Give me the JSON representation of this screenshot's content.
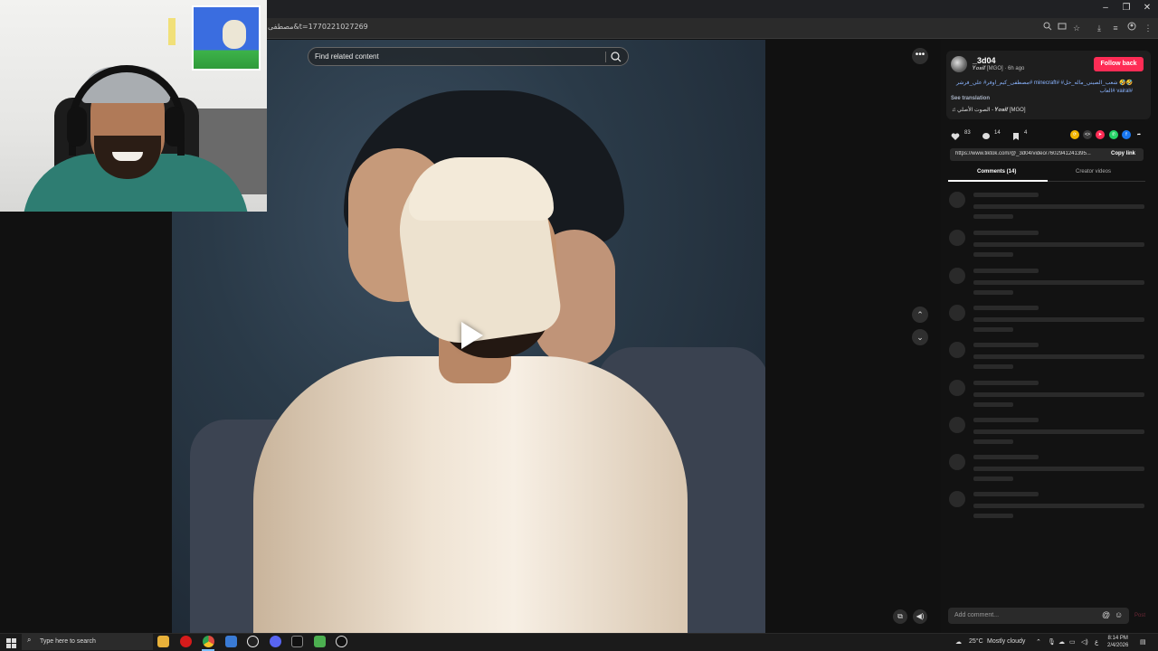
{
  "browser": {
    "url": "مصطفى&t=1770221027269",
    "window_controls": [
      "–",
      "❐",
      "✕"
    ]
  },
  "video": {
    "search_placeholder": "Find related content"
  },
  "post": {
    "username": "_3d04",
    "display_name": "𝒀𝒐𝒔𝒊𝒇 [MGO]",
    "time_ago": "6h ago",
    "follow_label": "Follow back",
    "caption_line1": "🤣🤣 شعب_الصيني_ماله_حل# #minecraft #مصطفى_كيم_اوفر# علي_فرشر",
    "caption_line2": "#vairal #العاب",
    "see_translation": "See translation",
    "music": "♫ الصوت الأصلي - 𝒀𝒐𝒔𝒊𝒇 [MGO]",
    "likes": "83",
    "comments": "14",
    "saves": "4",
    "link": "https://www.tiktok.com/@_3d04/video/7602941241395...",
    "copy_link_label": "Copy link"
  },
  "tabs": {
    "comments_label": "Comments (14)",
    "creator_label": "Creator videos"
  },
  "comment_input": {
    "placeholder": "Add comment...",
    "post_label": "Post"
  },
  "taskbar": {
    "search_text": "Type here to search",
    "weather_temp": "25°C",
    "weather_text": "Mostly cloudy",
    "time": "8:14 PM",
    "date": "2/4/2026",
    "lang": "ع"
  },
  "colors": {
    "accent": "#fe2c55",
    "hashtag": "#8ab4ff",
    "background": "#121212"
  }
}
